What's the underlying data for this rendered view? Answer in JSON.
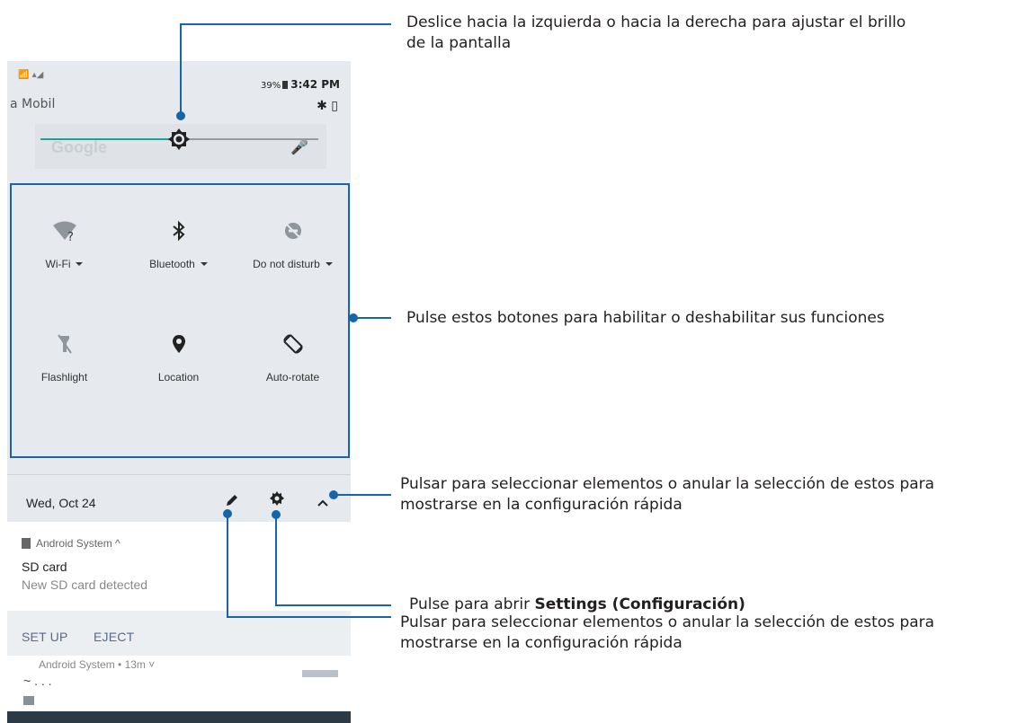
{
  "status_bar": {
    "left_icons": "📶 ▴◢",
    "carrier": "a Mobil",
    "battery_pct": "39%",
    "time": "3:42 PM",
    "right_icons": "✱ ▯"
  },
  "search_bar": {
    "placeholder": "Google"
  },
  "brightness": {
    "level": 0.5
  },
  "quick_tiles": [
    {
      "label": "Wi-Fi",
      "icon": "wifi-question-icon",
      "has_dropdown": true
    },
    {
      "label": "Bluetooth",
      "icon": "bluetooth-icon",
      "has_dropdown": true
    },
    {
      "label": "Do not disturb",
      "icon": "do-not-disturb-icon",
      "has_dropdown": true
    },
    {
      "label": "Flashlight",
      "icon": "flashlight-off-icon",
      "has_dropdown": false
    },
    {
      "label": "Location",
      "icon": "location-pin-icon",
      "has_dropdown": false
    },
    {
      "label": "Auto-rotate",
      "icon": "auto-rotate-icon",
      "has_dropdown": false
    }
  ],
  "date_row": {
    "date": "Wed, Oct 24"
  },
  "notification": {
    "app": "Android System ^",
    "title": "SD card",
    "subtitle": "New SD card detected",
    "actions": [
      "SET UP",
      "EJECT"
    ]
  },
  "notification2": {
    "app": "Android System • 13m ˅",
    "title_cut": "~        .      .     ."
  },
  "callouts": {
    "brightness": "Deslice hacia la izquierda o hacia la derecha para ajustar el brillo de la pantalla",
    "tiles": "Pulse estos botones para habilitar o deshabilitar sus funciones",
    "expand": "Pulsar para seleccionar elementos o anular la selección de estos para mostrarse en la configuración rápida",
    "settings_prefix": "Pulse para abrir ",
    "settings_bold": "Settings (Configuración)",
    "edit": "Pulsar para seleccionar elementos o anular la selección de estos para mostrarse en la configuración rápida"
  },
  "colors": {
    "accent": "#1565a8",
    "slider": "#1aa393",
    "panel": "#e6e9ed"
  }
}
